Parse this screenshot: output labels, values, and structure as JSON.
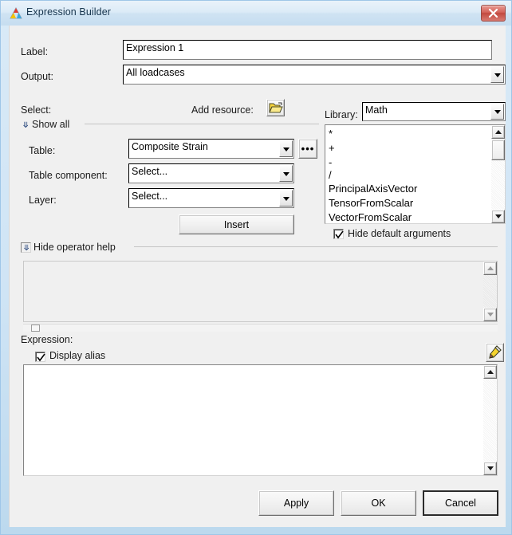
{
  "window": {
    "title": "Expression Builder",
    "app_icon": "altair-triangle-icon",
    "close_label": "x"
  },
  "form": {
    "label_caption": "Label:",
    "label_value": "Expression 1",
    "output_caption": "Output:",
    "output_value": "All loadcases"
  },
  "select_group": {
    "caption": "Select:",
    "add_resource_caption": "Add resource:",
    "add_resource_icon": "open-folder-icon",
    "show_all_caption": "Show all",
    "table_caption": "Table:",
    "table_value": "Composite Strain",
    "browse_label": "•••",
    "table_component_caption": "Table component:",
    "table_component_value": "Select...",
    "layer_caption": "Layer:",
    "layer_value": "Select...",
    "insert_label": "Insert"
  },
  "library_group": {
    "caption": "Library:",
    "value": "Math",
    "items": [
      "*",
      "+",
      "-",
      "/",
      "PrincipalAxisVector",
      "TensorFromScalar",
      "VectorFromScalar"
    ],
    "hide_default_arguments_label": "Hide default arguments",
    "hide_default_arguments_checked": true
  },
  "operator_help": {
    "caption": "Hide operator help",
    "text": ""
  },
  "expression_group": {
    "caption": "Expression:",
    "display_alias_label": "Display alias",
    "display_alias_checked": true,
    "edit_icon": "pencil-icon",
    "text": ""
  },
  "footer": {
    "apply_label": "Apply",
    "ok_label": "OK",
    "cancel_label": "Cancel"
  },
  "colors": {
    "frame": "#9fc6e8",
    "dialog_bg": "#f0f0f0",
    "close_red": "#c2493f",
    "title_text": "#16344d"
  }
}
